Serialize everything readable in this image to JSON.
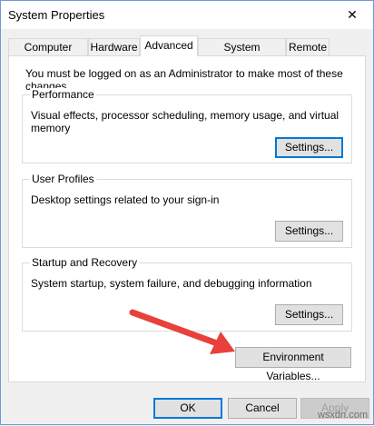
{
  "window": {
    "title": "System Properties",
    "close_glyph": "✕"
  },
  "tabs": [
    {
      "label": "Computer Name"
    },
    {
      "label": "Hardware"
    },
    {
      "label": "Advanced"
    },
    {
      "label": "System Protection"
    },
    {
      "label": "Remote"
    }
  ],
  "admin_note": "You must be logged on as an Administrator to make most of these changes.",
  "performance": {
    "title": "Performance",
    "description": "Visual effects, processor scheduling, memory usage, and virtual memory",
    "button": "Settings..."
  },
  "user_profiles": {
    "title": "User Profiles",
    "description": "Desktop settings related to your sign-in",
    "button": "Settings..."
  },
  "startup_recovery": {
    "title": "Startup and Recovery",
    "description": "System startup, system failure, and debugging information",
    "button": "Settings..."
  },
  "env_button": "Environment Variables...",
  "footer": {
    "ok": "OK",
    "cancel": "Cancel",
    "apply": "Apply"
  },
  "watermark": "wsxdn.com",
  "colors": {
    "arrow": "#e8403a",
    "focus_border": "#0078d7"
  }
}
